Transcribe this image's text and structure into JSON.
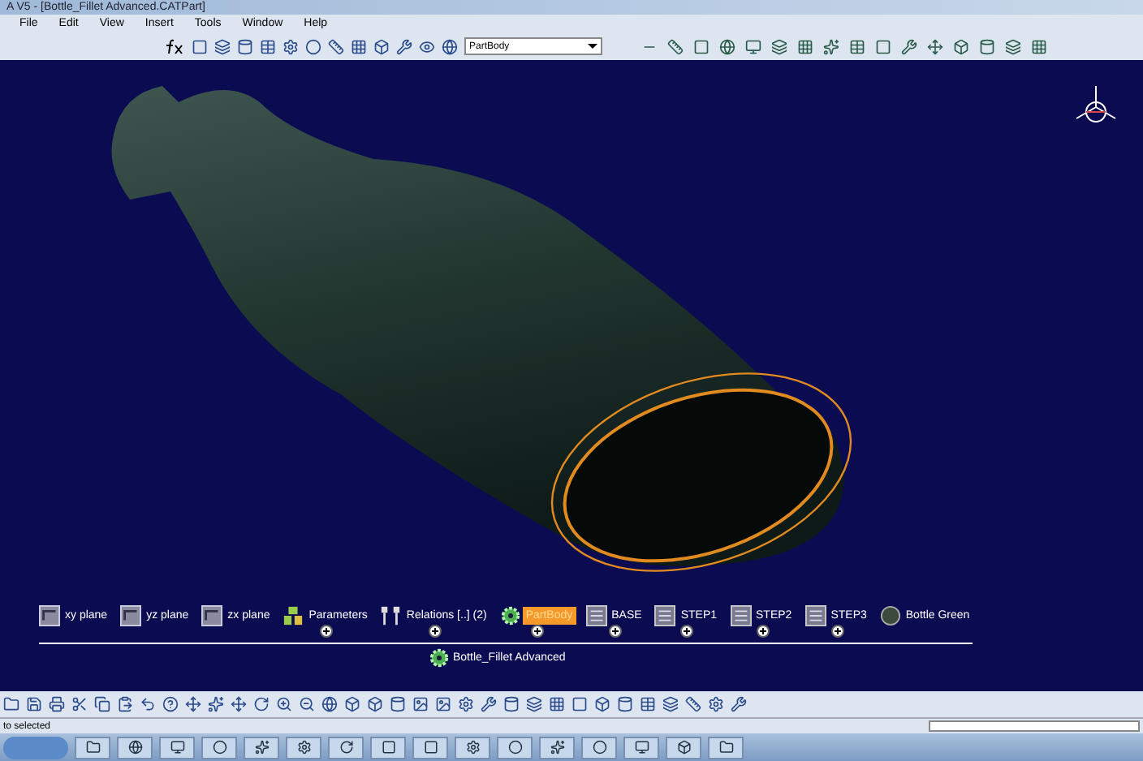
{
  "window": {
    "title": "A V5 - [Bottle_Fillet Advanced.CATPart]"
  },
  "menu": [
    "File",
    "Edit",
    "View",
    "Insert",
    "Tools",
    "Window",
    "Help"
  ],
  "toolbar": {
    "body_select": "PartBody"
  },
  "tree": {
    "root": "Bottle_Fillet Advanced",
    "children": [
      {
        "label": "xy plane",
        "kind": "plane",
        "selected": false,
        "expandable": false
      },
      {
        "label": "yz plane",
        "kind": "plane",
        "selected": false,
        "expandable": false
      },
      {
        "label": "zx plane",
        "kind": "plane",
        "selected": false,
        "expandable": false
      },
      {
        "label": "Parameters",
        "kind": "parameters",
        "selected": false,
        "expandable": true
      },
      {
        "label": "Relations [..] (2)",
        "kind": "relations",
        "selected": false,
        "expandable": true
      },
      {
        "label": "PartBody",
        "kind": "body",
        "selected": true,
        "expandable": true
      },
      {
        "label": "BASE",
        "kind": "set",
        "selected": false,
        "expandable": true
      },
      {
        "label": "STEP1",
        "kind": "set",
        "selected": false,
        "expandable": true
      },
      {
        "label": "STEP2",
        "kind": "set",
        "selected": false,
        "expandable": true
      },
      {
        "label": "STEP3",
        "kind": "set",
        "selected": false,
        "expandable": true
      },
      {
        "label": "Bottle Green",
        "kind": "material",
        "selected": false,
        "expandable": false
      }
    ]
  },
  "status_bar": {
    "message": "to selected"
  }
}
